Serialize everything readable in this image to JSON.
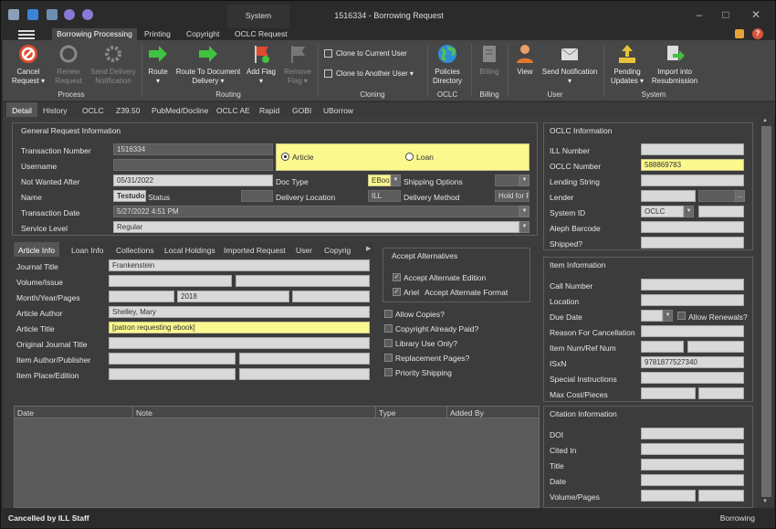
{
  "window": {
    "title": "1516334 - Borrowing Request",
    "system_tab": "System",
    "help_icon": "?",
    "min_icon": "–",
    "max_icon": "□",
    "close_icon": "✕"
  },
  "ribbon_tabs": [
    "Borrowing Processing",
    "Printing",
    "Copyright",
    "OCLC Request"
  ],
  "ribbon": {
    "cancel": "Cancel\nRequest ▾",
    "renew": "Renew\nRequest",
    "send_delivery": "Send Delivery\nNotification",
    "route": "Route\n▾",
    "route_doc": "Route To Document\nDelivery ▾",
    "add_flag": "Add Flag\n▾",
    "remove_flag": "Remove\nFlag ▾",
    "clone_current": "Clone to Current User",
    "clone_another": "Clone to Another User ▾",
    "policies": "Policies\nDirectory",
    "billing": "Billing",
    "view": "View",
    "send_notification": "Send Notification\n▾",
    "pending": "Pending\nUpdates ▾",
    "import": "Import into\nResubmission",
    "groups": {
      "process": "Process",
      "routing": "Routing",
      "cloning": "Cloning",
      "oclc": "OCLC",
      "billing": "Billing",
      "user": "User",
      "system": "System"
    }
  },
  "doc_tabs": [
    "Detail",
    "History",
    "OCLC",
    "Z39.50",
    "PubMed/Docline",
    "OCLC AE",
    "Rapid",
    "GOBI",
    "UBorrow"
  ],
  "general": {
    "title": "General Request Information",
    "transaction_number_label": "Transaction Number",
    "transaction_number": "1516334",
    "username_label": "Username",
    "username": "",
    "not_wanted_label": "Not Wanted After",
    "not_wanted": "05/31/2022",
    "name_label": "Name",
    "name": "Testudo",
    "status_label": "Status",
    "status": "",
    "transaction_date_label": "Transaction Date",
    "transaction_date": "5/27/2022 4:51 PM",
    "service_level_label": "Service Level",
    "service_level": "Regular",
    "article_label": "Article",
    "loan_label": "Loan",
    "doc_type_label": "Doc Type",
    "doc_type": "EBook",
    "shipping_options_label": "Shipping Options",
    "shipping_options": "",
    "delivery_location_label": "Delivery Location",
    "delivery_location": "ILL",
    "delivery_method_label": "Delivery Method",
    "delivery_method": "Hold for Pi"
  },
  "sub_tabs": [
    "Article Info",
    "Loan Info",
    "Collections",
    "Local Holdings",
    "Imported Request",
    "User",
    "Copyrig"
  ],
  "article": {
    "journal_title_label": "Journal Title",
    "journal_title": "Frankenstein",
    "volume_label": "Volume/Issue",
    "month_label": "Month/Year/Pages",
    "year": "2018",
    "author_label": "Article Author",
    "author": "Shelley, Mary",
    "article_title_label": "Article Title",
    "article_title": "[patron requesting ebook]",
    "orig_journal_label": "Original Journal Title",
    "item_author_label": "Item Author/Publisher",
    "item_place_label": "Item Place/Edition"
  },
  "accept_alt": {
    "title": "Accept Alternatives",
    "edition": "Accept Alternate Edition",
    "ariel": "Ariel",
    "format": "Accept Alternate Format"
  },
  "checks": [
    "Allow Copies?",
    "Copyright Already Paid?",
    "Library Use Only?",
    "Replacement Pages?",
    "Priority Shipping"
  ],
  "grid_headers": [
    "Date",
    "Note",
    "Type",
    "Added By"
  ],
  "oclc": {
    "title": "OCLC Information",
    "ill_number_label": "ILL Number",
    "oclc_number_label": "OCLC Number",
    "oclc_number": "588869783",
    "lending_string_label": "Lending String",
    "lender_label": "Lender",
    "system_id_label": "System ID",
    "system_id": "OCLC",
    "aleph_label": "Aleph Barcode",
    "shipped_label": "Shipped?"
  },
  "item": {
    "title": "Item Information",
    "call_label": "Call Number",
    "location_label": "Location",
    "due_label": "Due Date",
    "renewals_label": "Allow Renewals?",
    "reason_label": "Reason For Cancellation",
    "itemnum_label": "Item Num/Ref Num",
    "isxn_label": "ISxN",
    "isxn": "9781877527340",
    "special_label": "Special Instructions",
    "maxcost_label": "Max Cost/Pieces"
  },
  "citation": {
    "title": "Citation Information",
    "doi_label": "DOI",
    "cited_label": "Cited In",
    "title_label": "Title",
    "date_label": "Date",
    "volpages_label": "Volume/Pages"
  },
  "status_bar": {
    "left": "Cancelled by ILL Staff",
    "right": "Borrowing"
  }
}
